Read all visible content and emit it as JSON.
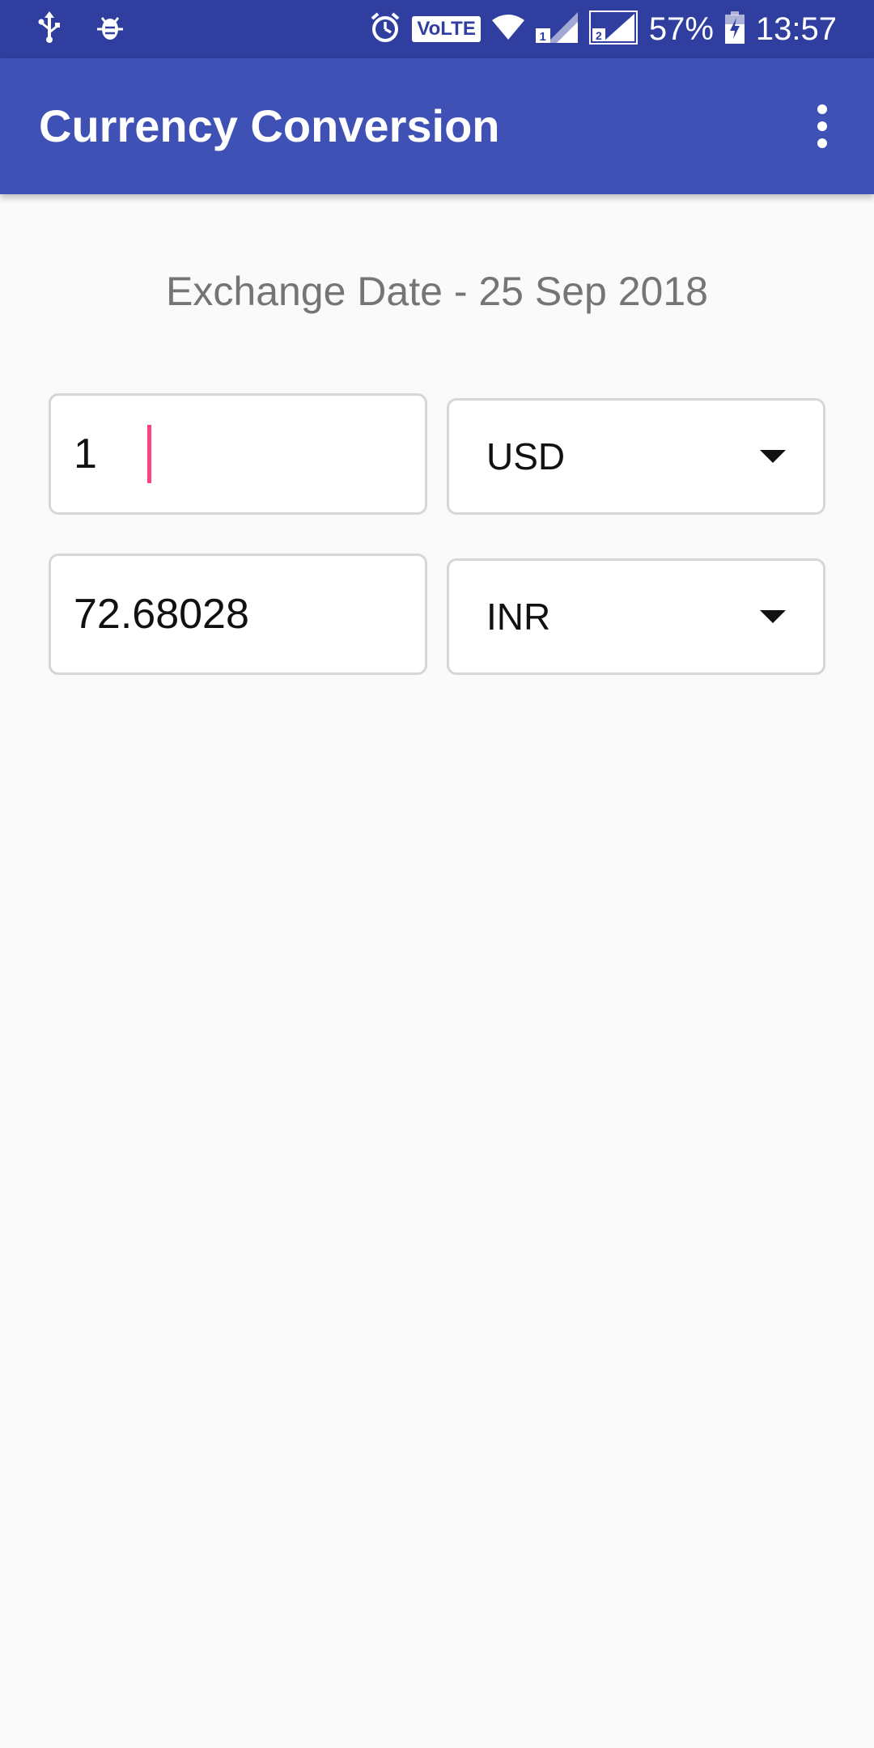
{
  "status_bar": {
    "icons": [
      "usb-icon",
      "bug-icon",
      "alarm-icon",
      "wifi-icon",
      "signal-sim1-icon",
      "signal-sim2-icon",
      "battery-charging-icon"
    ],
    "volte": "VoLTE",
    "battery": "57%",
    "time": "13:57"
  },
  "app_bar": {
    "title": "Currency Conversion",
    "menu_icon": "more-vert-icon"
  },
  "exchange_date": "Exchange Date - 25 Sep 2018",
  "from": {
    "amount": "1",
    "currency": "USD"
  },
  "to": {
    "amount": "72.68028",
    "currency": "INR"
  },
  "colors": {
    "status_bar": "#303f9f",
    "app_bar": "#3f51b5",
    "caret": "#ff4081",
    "background": "#fafafa"
  }
}
